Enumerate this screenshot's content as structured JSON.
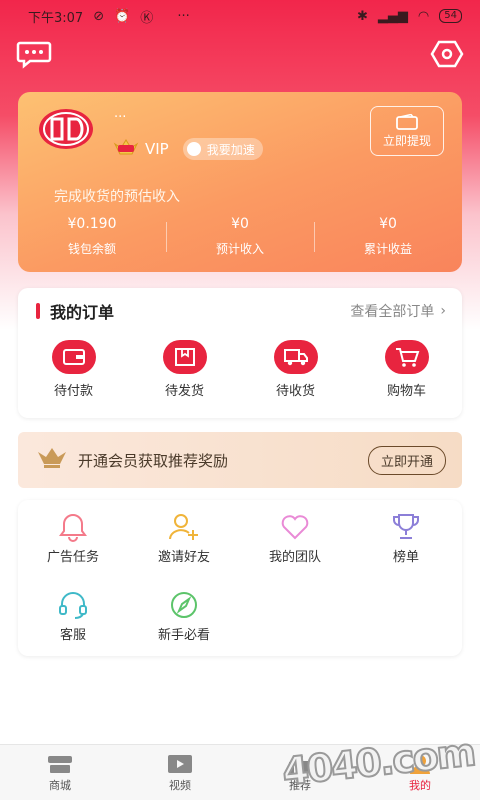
{
  "status_bar": {
    "time": "下午3:07",
    "dots": "···",
    "battery": "54"
  },
  "card": {
    "user_dots": "···",
    "vip_label": "VIP",
    "speed_label": "我要加速",
    "withdraw_label": "立即提现",
    "subtitle": "完成收货的预估收入",
    "stats": [
      {
        "value": "¥0.190",
        "label": "钱包余额"
      },
      {
        "value": "¥0",
        "label": "预计收入"
      },
      {
        "value": "¥0",
        "label": "累计收益"
      }
    ]
  },
  "orders": {
    "title": "我的订单",
    "view_all": "查看全部订单",
    "items": [
      {
        "label": "待付款",
        "icon": "wallet-icon"
      },
      {
        "label": "待发货",
        "icon": "package-icon"
      },
      {
        "label": "待收货",
        "icon": "truck-icon"
      },
      {
        "label": "购物车",
        "icon": "cart-icon"
      }
    ]
  },
  "banner": {
    "text": "开通会员获取推荐奖励",
    "button": "立即开通"
  },
  "tools": [
    {
      "label": "广告任务",
      "icon": "bell-icon"
    },
    {
      "label": "邀请好友",
      "icon": "add-user-icon"
    },
    {
      "label": "我的团队",
      "icon": "heart-icon"
    },
    {
      "label": "榜单",
      "icon": "trophy-icon"
    },
    {
      "label": "客服",
      "icon": "headset-icon"
    },
    {
      "label": "新手必看",
      "icon": "compass-icon"
    }
  ],
  "tabbar": [
    {
      "label": "商城",
      "icon": "store-icon"
    },
    {
      "label": "视频",
      "icon": "video-icon"
    },
    {
      "label": "推荐",
      "icon": "thumbs-up-icon"
    },
    {
      "label": "我的",
      "icon": "profile-icon",
      "active": true
    }
  ],
  "watermark": "4040.com",
  "colors": {
    "accent": "#e8243f",
    "card_start": "#fdc172",
    "card_end": "#f9845c"
  }
}
